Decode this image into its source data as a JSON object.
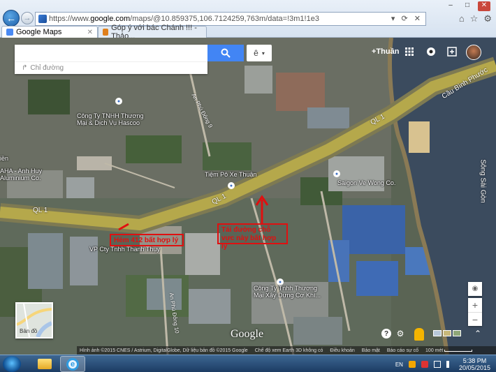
{
  "browser": {
    "url_prefix": "https://www.",
    "url_host": "google.com",
    "url_path": "/maps/@10.859375,106.7124259,763m/data=!3m1!1e3",
    "tabs": [
      {
        "label": "Google Maps",
        "close": "✕"
      },
      {
        "label": "Góp ý với bác Chánh !!! - Thảo..."
      }
    ],
    "address_tools": "▾ ⟳ ✕",
    "window_controls": [
      "–",
      "□",
      "✕"
    ],
    "toolbar_icons": [
      "⌂",
      "☆",
      "⚙"
    ]
  },
  "maps": {
    "search": {
      "value": "",
      "placeholder": ""
    },
    "directions_label": "Chỉ đường",
    "lang_label": "ê",
    "lang_caret": "▾",
    "user_link": "+Thuần",
    "earth_thumb_label": "Bản đồ",
    "logo": "Google",
    "zoom": {
      "in": "+",
      "out": "−",
      "locate": "◉"
    },
    "controls": {
      "help": "?",
      "settings": "⚙",
      "expand": "⌃"
    },
    "footer": {
      "credit": "Hình ảnh ©2015 CNES / Astrium, DigitalGlobe, Dữ liệu bản đồ ©2015 Google",
      "earth_mode": "Chế độ xem Earth 3D không có",
      "terms": "Điều khoản",
      "privacy": "Bảo mật",
      "report": "Báo cáo sự cố",
      "scale": "100 mét"
    }
  },
  "map_labels": {
    "poi": [
      {
        "text": "Công Ty TNHH Thương",
        "text2": "Mại & Dịch Vụ Hascoo"
      },
      {
        "text": "Tiệm Pô Xe Thuận"
      },
      {
        "text": "Saigon Ve Wong Co."
      },
      {
        "text": "VP Cty Tnhh Thanh Thụy"
      },
      {
        "text": "Công Ty Tnhh Thương",
        "text2": "Mại Xây Dựng Cơ Khí..."
      },
      {
        "text": "AHA - Anh Huy",
        "text2": "Aluminium Co."
      }
    ],
    "roads": {
      "ql1_a": "QL 1",
      "ql1_b": "QL 1",
      "bridge": "Cầu Bình Phước",
      "river": "Sông Sài Gòn",
      "street_1": "An Phú Đông 9",
      "street_2": "An Phú Đông 10"
    },
    "left_edge": "iền"
  },
  "annotations": {
    "left": "Hẻm 412 bất hợp lý",
    "right_line1": "Tái đường chỗ",
    "right_line2": "vực này bất hợp lý"
  },
  "taskbar": {
    "lang": "EN",
    "time": "5:38 PM",
    "date": "20/05/2015"
  },
  "colors": {
    "search_blue": "#4285f4",
    "annotation_red": "#e01010",
    "road_yellow": "#c8b84a",
    "river": "#3b4b5e"
  }
}
